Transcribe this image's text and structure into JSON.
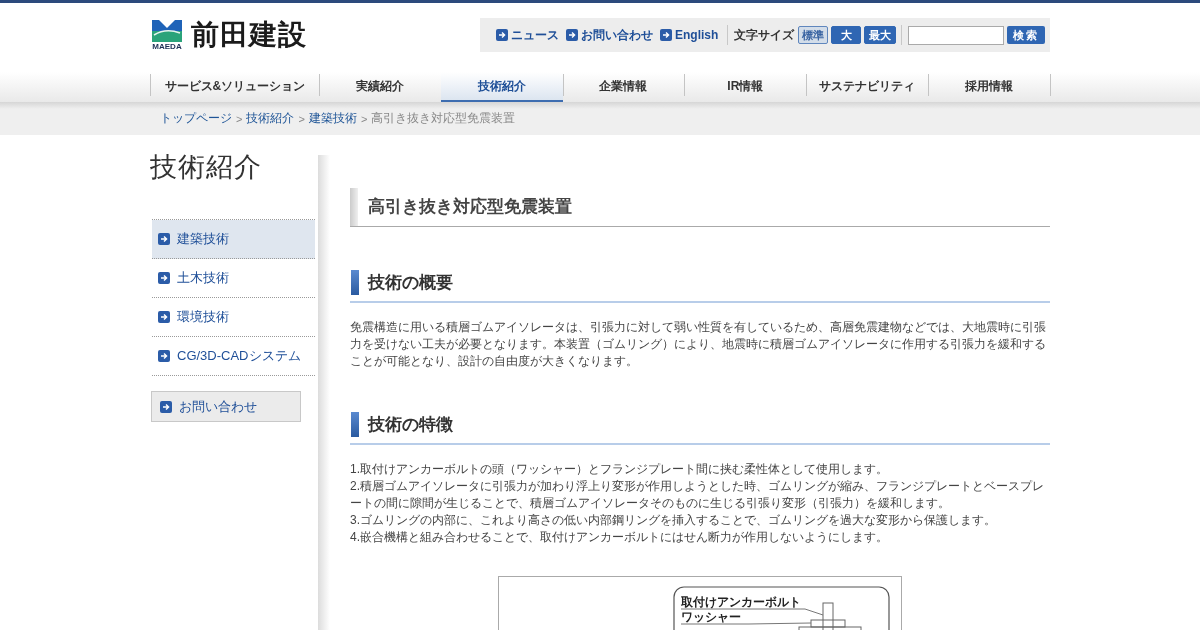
{
  "header": {
    "logo": {
      "name": "前田建設",
      "caption": "MAEDA"
    },
    "links": [
      {
        "label": "ニュース"
      },
      {
        "label": "お問い合わせ"
      },
      {
        "label": "English"
      }
    ],
    "font_size": {
      "label": "文字サイズ",
      "options": [
        {
          "label": "標準",
          "selected": true
        },
        {
          "label": "大",
          "selected": false
        },
        {
          "label": "最大",
          "selected": false
        }
      ]
    },
    "search": {
      "button": "検索"
    }
  },
  "nav": [
    {
      "label": "サービス&ソリューション",
      "selected": false
    },
    {
      "label": "実績紹介",
      "selected": false
    },
    {
      "label": "技術紹介",
      "selected": true
    },
    {
      "label": "企業情報",
      "selected": false
    },
    {
      "label": "IR情報",
      "selected": false
    },
    {
      "label": "サステナビリティ",
      "selected": false
    },
    {
      "label": "採用情報",
      "selected": false
    }
  ],
  "breadcrumb": {
    "separator": ">",
    "items": [
      {
        "label": "トップページ",
        "kind": "link"
      },
      {
        "label": "技術紹介",
        "kind": "link"
      },
      {
        "label": "建築技術",
        "kind": "link"
      },
      {
        "label": "高引き抜き対応型免震装置",
        "kind": "current"
      }
    ]
  },
  "sidebar": {
    "title": "技術紹介",
    "items": [
      {
        "label": "建築技術",
        "selected": true
      },
      {
        "label": "土木技術",
        "selected": false
      },
      {
        "label": "環境技術",
        "selected": false
      },
      {
        "label": "CG/3D-CADシステム",
        "selected": false
      }
    ],
    "contact_button": "お問い合わせ"
  },
  "content": {
    "title": "高引き抜き対応型免震装置",
    "sections": [
      {
        "heading": "技術の概要",
        "kind": "paragraph",
        "text": "免震構造に用いる積層ゴムアイソレータは、引張力に対して弱い性質を有しているため、高層免震建物などでは、大地震時に引張力を受けない工夫が必要となります。本装置（ゴムリング）により、地震時に積層ゴムアイソレータに作用する引張力を緩和することが可能となり、設計の自由度が大きくなります。"
      },
      {
        "heading": "技術の特徴",
        "kind": "list",
        "items": [
          "1.取付けアンカーボルトの頭（ワッシャー）とフランジプレート間に挟む柔性体として使用します。",
          "2.積層ゴムアイソレータに引張力が加わり浮上り変形が作用しようとした時、ゴムリングが縮み、フランジプレートとベースプレートの間に隙間が生じることで、積層ゴムアイソレータそのものに生じる引張り変形（引張力）を緩和します。",
          "3.ゴムリングの内部に、これより高さの低い内部鋼リングを挿入することで、ゴムリングを過大な変形から保護します。",
          "4.嵌合機構と組み合わせることで、取付けアンカーボルトにはせん断力が作用しないようにします。"
        ]
      }
    ],
    "figure": {
      "labels": [
        "取付けアンカーボルト",
        "ワッシャー"
      ]
    }
  }
}
